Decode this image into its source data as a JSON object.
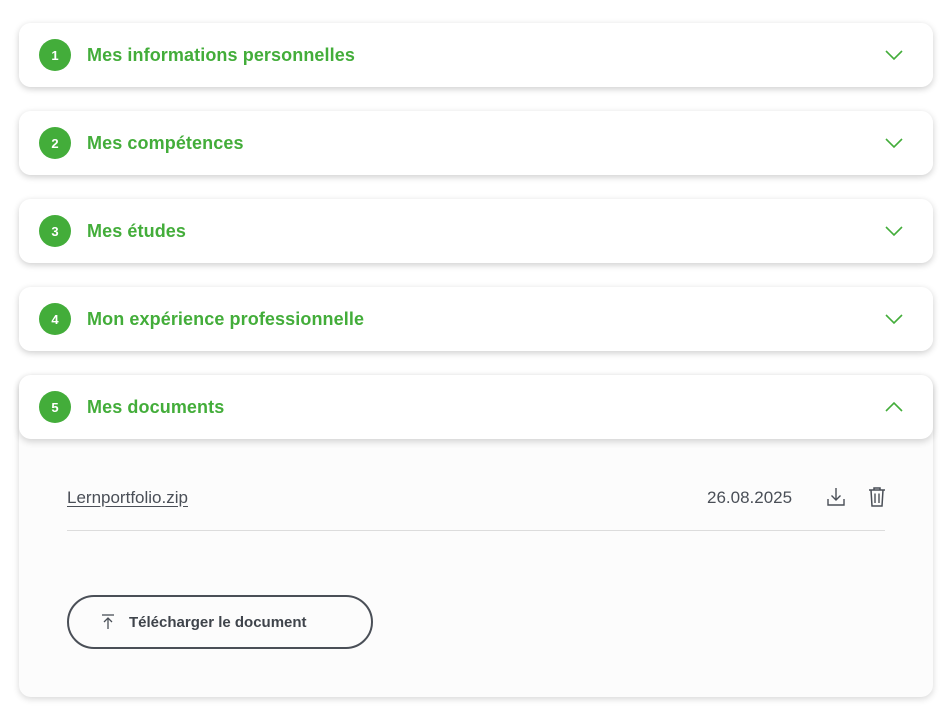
{
  "sections": [
    {
      "number": "1",
      "title": "Mes informations personnelles"
    },
    {
      "number": "2",
      "title": "Mes compétences"
    },
    {
      "number": "3",
      "title": "Mes études"
    },
    {
      "number": "4",
      "title": "Mon expérience professionnelle"
    },
    {
      "number": "5",
      "title": "Mes documents"
    }
  ],
  "documents": [
    {
      "name": "Lernportfolio.zip",
      "date": "26.08.2025"
    }
  ],
  "upload_label": "Télécharger le document",
  "icons": {
    "collapsed": "chevron-down-icon",
    "expanded": "chevron-up-icon",
    "download": "download-icon",
    "delete": "trash-icon",
    "upload": "upload-icon"
  },
  "colors": {
    "accent": "#43ad3a",
    "text": "#4a4f57"
  }
}
